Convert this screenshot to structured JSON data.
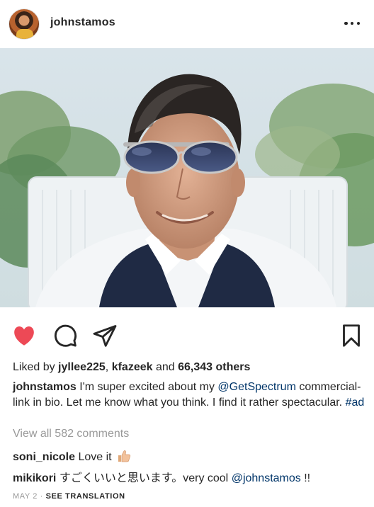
{
  "post": {
    "username": "johnstamos",
    "likes": {
      "prefix": "Liked by",
      "user1": "jyllee225",
      "separator": ",",
      "user2": "kfazeek",
      "and": "and",
      "count": "66,343 others"
    },
    "caption": {
      "username": "johnstamos",
      "text_before_mention": "I'm super excited about my",
      "mention": "@GetSpectrum",
      "text_after_mention": "commercial-link in bio.  Let me know what you think. I find it rather spectacular.",
      "hashtag": "#ad"
    },
    "view_all_comments": "View all 582 comments",
    "comments": [
      {
        "username": "soni_nicole",
        "text": "Love it",
        "emoji": "thumbs-up"
      },
      {
        "username": "mikikori",
        "text": "すごくいいと思います。very cool",
        "mention": "@johnstamos",
        "tail": "!!"
      }
    ],
    "date": "MAY 2",
    "dot": "·",
    "see_translation": "SEE TRANSLATION",
    "liked": true
  },
  "colors": {
    "heart": "#ed4956",
    "link": "#003569",
    "muted": "#999999",
    "text": "#262626"
  },
  "icons": {
    "more": "more-options-icon",
    "like": "heart-icon",
    "comment": "comment-icon",
    "share": "send-icon",
    "save": "bookmark-icon"
  }
}
